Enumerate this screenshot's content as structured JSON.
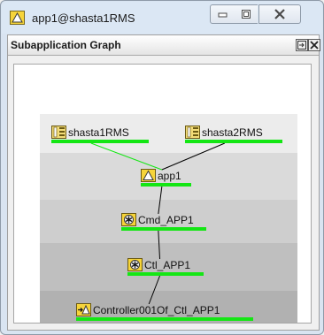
{
  "window": {
    "title": "app1@shasta1RMS"
  },
  "panel": {
    "title": "Subapplication Graph"
  },
  "graph": {
    "nodes": [
      {
        "id": "shasta1RMS",
        "label": "shasta1RMS",
        "icon": "system-node-icon"
      },
      {
        "id": "shasta2RMS",
        "label": "shasta2RMS",
        "icon": "system-node-icon"
      },
      {
        "id": "app1",
        "label": "app1",
        "icon": "application-triangle-icon"
      },
      {
        "id": "Cmd_APP1",
        "label": "Cmd_APP1",
        "icon": "star-resource-icon"
      },
      {
        "id": "Ctl_APP1",
        "label": "Ctl_APP1",
        "icon": "star-resource-icon"
      },
      {
        "id": "Controller001Of_Ctl_APP1",
        "label": "Controller001Of_Ctl_APP1",
        "icon": "controller-arrow-icon"
      }
    ],
    "edges": [
      {
        "from": "shasta1RMS",
        "to": "app1",
        "color": "#14e614"
      },
      {
        "from": "shasta2RMS",
        "to": "app1",
        "color": "#000000"
      },
      {
        "from": "app1",
        "to": "Cmd_APP1",
        "color": "#000000"
      },
      {
        "from": "Cmd_APP1",
        "to": "Ctl_APP1",
        "color": "#000000"
      },
      {
        "from": "Ctl_APP1",
        "to": "Controller001Of_Ctl_APP1",
        "color": "#000000"
      }
    ],
    "status_color": "#14e614"
  }
}
